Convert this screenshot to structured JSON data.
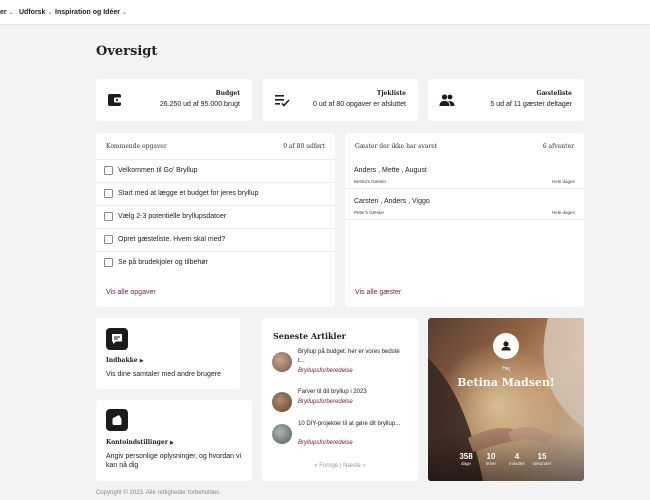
{
  "nav": [
    {
      "label": "ler"
    },
    {
      "label": "Udforsk"
    },
    {
      "label": "Inspiration og Idéer"
    }
  ],
  "page_title": "Oversigt",
  "stats": {
    "budget": {
      "title": "Budget",
      "value": "26.250  ud af 95.000  brugt"
    },
    "checklist": {
      "title": "Tjekliste",
      "value": "0 ud af 80 opgaver er afsluttet"
    },
    "guests": {
      "title": "Gæsteliste",
      "value": "5 ud af 11 gæster deltager"
    }
  },
  "tasks": {
    "title": "Kommende opgaver",
    "count": "0 af 80 udført",
    "items": [
      {
        "label": "Velkommen til Go' Bryllup"
      },
      {
        "label": "Start med at lægge et budget for jeres bryllup"
      },
      {
        "label": "Vælg 2-3 potentielle bryllupsdatoer"
      },
      {
        "label": "Opret gæsteliste. Hvem skal med?"
      },
      {
        "label": "Se på brudekjoler og tilbehør"
      }
    ],
    "link": "Vis alle opgaver"
  },
  "guests": {
    "title": "Gæster der ikke har svaret",
    "count": "6 afventer",
    "items": [
      {
        "names": "Anders , Mette , August",
        "group": "Betina's Gæster",
        "time": "Hele dagen"
      },
      {
        "names": "Carsten , Anders , Viggo",
        "group": "Peter's Gæster",
        "time": "Hele dagen"
      }
    ],
    "link": "Vis alle gæster"
  },
  "inbox": {
    "title": "Indbakke",
    "desc": "Vis dine samtaler med andre brugere"
  },
  "account": {
    "title": "Kontoindstillinger",
    "desc": "Angiv personlige oplysninger, og hvordan vi kan nå dig"
  },
  "articles": {
    "title": "Seneste Artikler",
    "items": [
      {
        "title": "Bryllup på budget: her er vores bedste t...",
        "category": "Bryllupsforberedelse"
      },
      {
        "title": "Farver til dit bryllup i 2023",
        "category": "Bryllupsforberedelse"
      },
      {
        "title": "10 DIY-projekter til at gøre dit bryllup...",
        "category": "Bryllupsforberedelse"
      }
    ],
    "prev": "« Forrige",
    "sep": "|",
    "next": "Næste »"
  },
  "profile": {
    "greeting": "Hej",
    "name": "Betina Madsen!",
    "countdown": [
      {
        "value": "358",
        "unit": "dage"
      },
      {
        "value": "10",
        "unit": "timer"
      },
      {
        "value": "4",
        "unit": "minutter"
      },
      {
        "value": "15",
        "unit": "sekunder"
      }
    ]
  },
  "footer": "Copyright © 2023. Alle rettigheder forbeholdes.",
  "colors": {
    "accent": "#7b2048",
    "background": "#f3f3f3",
    "icon": "#1c1c1c"
  }
}
